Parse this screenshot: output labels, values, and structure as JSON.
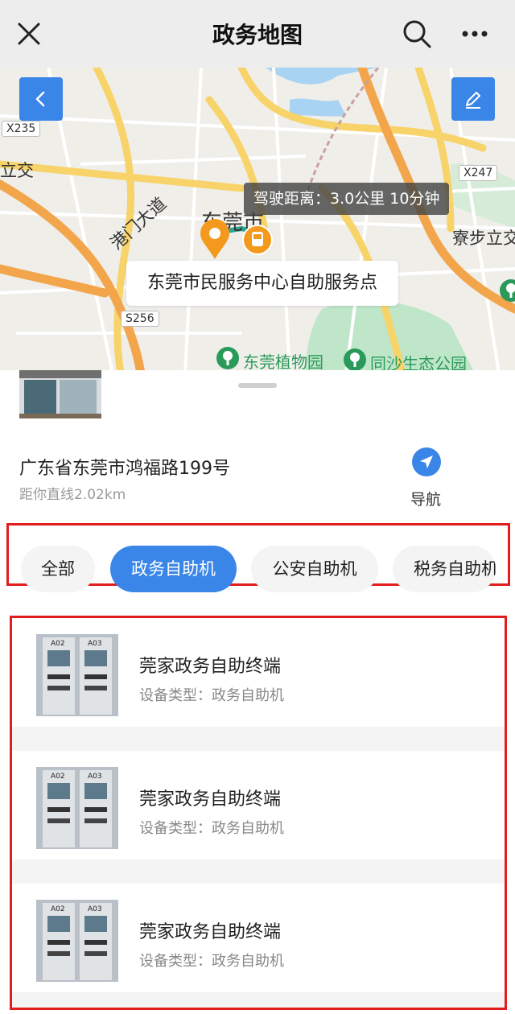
{
  "header": {
    "title": "政务地图"
  },
  "map": {
    "road_tags": [
      "X235",
      "X247",
      "S256"
    ],
    "labels": {
      "lijiao": "立交",
      "city": "东莞市",
      "gangmen": "港门大道",
      "suobu": "寮步立交"
    },
    "drive_tip": "驾驶距离：3.0公里 10分钟",
    "place_name": "东莞市民服务中心自助服务点",
    "pois": [
      "东莞植物园",
      "同沙生态公园"
    ]
  },
  "detail": {
    "address": "广东省东莞市鸿福路199号",
    "distance": "距你直线2.02km",
    "nav_label": "导航"
  },
  "filters": {
    "chips": [
      "全部",
      "政务自助机",
      "公安自助机",
      "税务自助机"
    ],
    "active_index": 1
  },
  "devices": [
    {
      "title": "莞家政务自助终端",
      "type": "设备类型：政务自助机",
      "thumb_labels": [
        "A02",
        "A03"
      ]
    },
    {
      "title": "莞家政务自助终端",
      "type": "设备类型：政务自助机",
      "thumb_labels": [
        "A02",
        "A03"
      ]
    },
    {
      "title": "莞家政务自助终端",
      "type": "设备类型：政务自助机",
      "thumb_labels": [
        "A02",
        "A03"
      ]
    }
  ],
  "colors": {
    "accent": "#3a86e8",
    "highlight_border": "#e11d1d",
    "poi_green": "#2a9a5a",
    "pin_orange": "#f39a1e"
  },
  "icons": [
    "close-icon",
    "search-icon",
    "more-icon",
    "back-icon",
    "edit-icon",
    "navigate-icon",
    "location-pin-icon",
    "bus-stop-icon",
    "park-icon"
  ]
}
